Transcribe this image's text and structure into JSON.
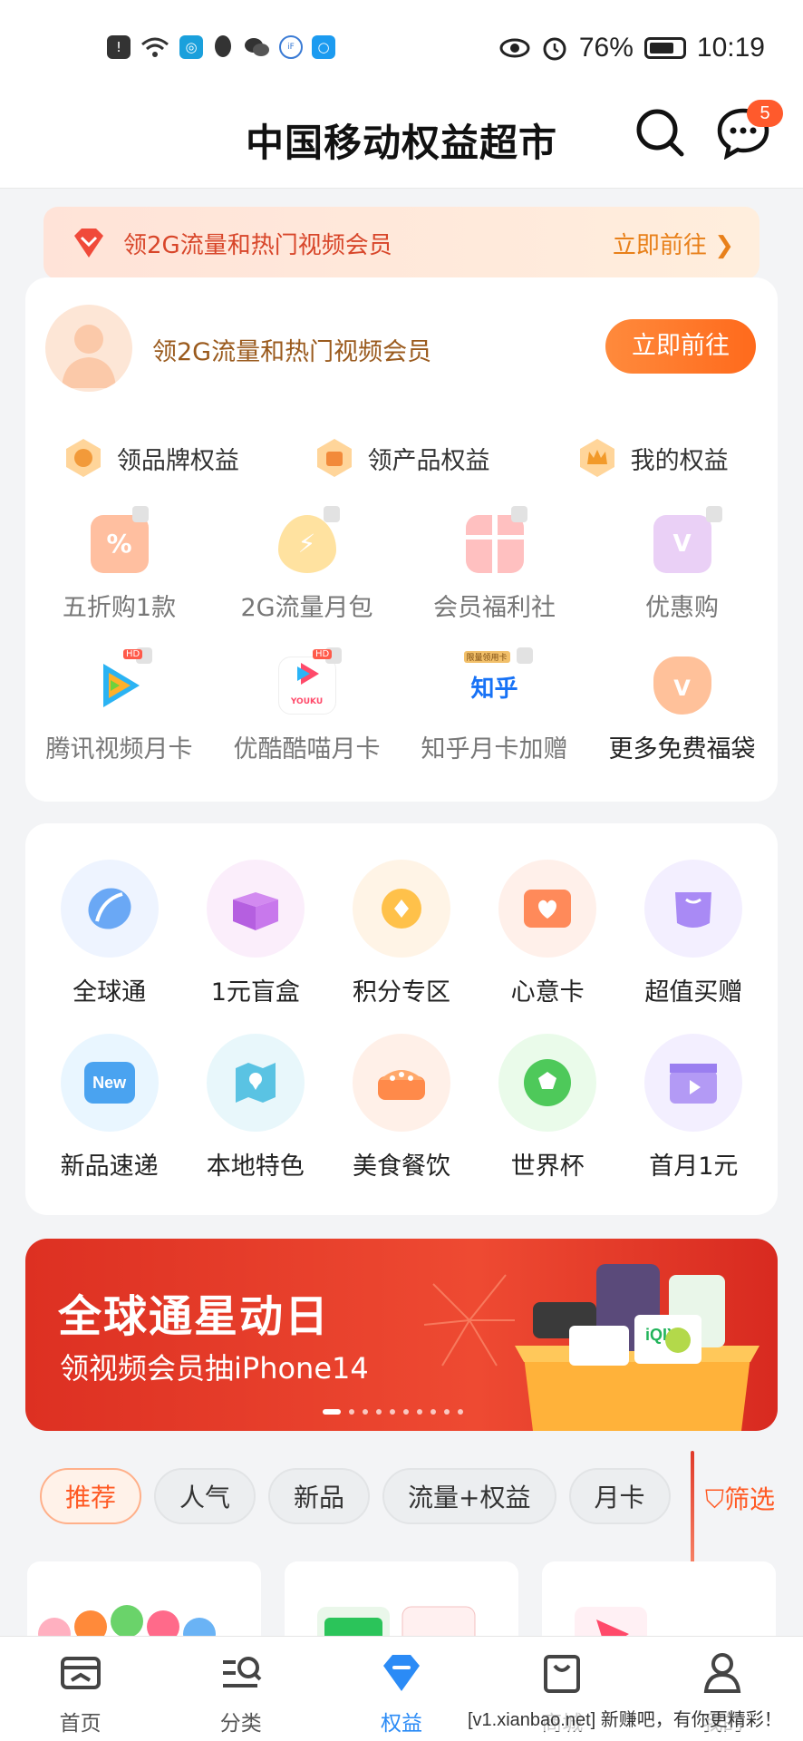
{
  "status_bar": {
    "battery": "76%",
    "time": "10:19",
    "battery_level": 0.76
  },
  "header": {
    "title": "中国移动权益超市",
    "message_badge": "5"
  },
  "promo_strip": {
    "text": "领2G流量和热门视频会员",
    "action": "立即前往"
  },
  "member_card": {
    "promo_text": "领2G流量和热门视频会员",
    "button": "立即前往",
    "tabs": [
      "领品牌权益",
      "领产品权益",
      "我的权益"
    ],
    "row1": [
      {
        "label": "五折购1款",
        "icon": "discount-icon",
        "color": "#ffb592"
      },
      {
        "label": "2G流量月包",
        "icon": "flow-icon",
        "color": "#ffd98a"
      },
      {
        "label": "会员福利社",
        "icon": "gift-icon",
        "color": "#ffb0b0"
      },
      {
        "label": "优惠购",
        "icon": "bag-icon",
        "color": "#e8c7f3"
      }
    ],
    "row2": [
      {
        "label": "腾讯视频月卡",
        "icon": "tencent-video-icon",
        "tag": "HD"
      },
      {
        "label": "优酷酷喵月卡",
        "icon": "youku-icon",
        "tag": "HD",
        "logo_text": "YOUKU"
      },
      {
        "label": "知乎月卡加赠",
        "icon": "zhihu-icon",
        "tag": "限量领用卡",
        "logo_text": "知乎"
      },
      {
        "label": "更多免费福袋",
        "icon": "lucky-bag-icon"
      }
    ]
  },
  "services": {
    "row1": [
      {
        "label": "全球通",
        "icon": "global-icon"
      },
      {
        "label": "1元盲盒",
        "icon": "blind-box-icon"
      },
      {
        "label": "积分专区",
        "icon": "points-icon"
      },
      {
        "label": "心意卡",
        "icon": "heart-card-icon"
      },
      {
        "label": "超值买赠",
        "icon": "bonus-bag-icon"
      }
    ],
    "row2": [
      {
        "label": "新品速递",
        "icon": "new-icon",
        "logo_text": "New"
      },
      {
        "label": "本地特色",
        "icon": "map-icon"
      },
      {
        "label": "美食餐饮",
        "icon": "food-icon"
      },
      {
        "label": "世界杯",
        "icon": "football-icon"
      },
      {
        "label": "首月1元",
        "icon": "video-clapper-icon"
      }
    ]
  },
  "banner": {
    "title": "全球通星动日",
    "subtitle": "领视频会员抽iPhone14",
    "dots": 10,
    "active_dot": 0
  },
  "filters": {
    "chips": [
      "推荐",
      "人气",
      "新品",
      "流量+权益",
      "月卡"
    ],
    "active": 0,
    "filter_button": "筛选"
  },
  "bottom_nav": {
    "items": [
      "首页",
      "分类",
      "权益",
      "商城",
      "我的"
    ],
    "active": 2
  },
  "watermark": "[v1.xianbao.net] 新赚吧，有你更精彩！"
}
